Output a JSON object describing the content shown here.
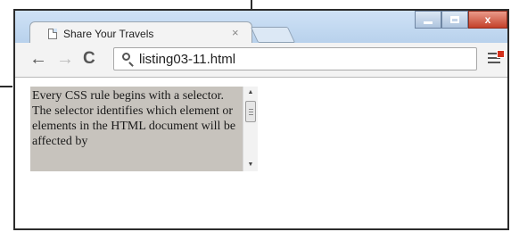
{
  "browser": {
    "tab": {
      "title": "Share Your Travels",
      "close_glyph": "×",
      "icon": "page-icon"
    },
    "window_controls": {
      "minimize_icon": "minimize-icon",
      "maximize_icon": "maximize-icon",
      "close_glyph": "x"
    },
    "toolbar": {
      "back_glyph": "←",
      "forward_glyph": "→",
      "reload_glyph": "C",
      "url": "listing03-11.html",
      "search_icon": "search-icon",
      "menu_icon": "menu-icon"
    }
  },
  "page": {
    "scroll_box": {
      "text": "Every CSS rule begins with a selector. The selector identifies which element or elements in the HTML document will be affected by",
      "up_arrow": "▲",
      "down_arrow": "▼",
      "background": "#c7c3bd"
    }
  },
  "colors": {
    "frame": "#cfe2f6",
    "close_button": "#c4412a"
  }
}
